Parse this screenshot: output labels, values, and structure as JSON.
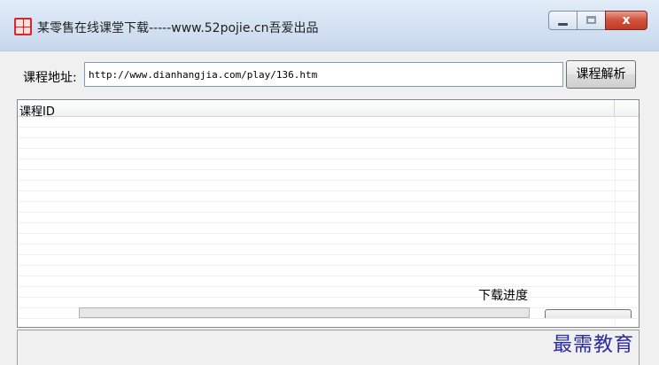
{
  "window": {
    "title": "某零售在线课堂下载-----www.52pojie.cn吾爱出品",
    "close_glyph": "x"
  },
  "form": {
    "url_label": "课程地址:",
    "url_value": "http://www.dianhangjia.com/play/136.htm",
    "parse_button": "课程解析"
  },
  "list": {
    "columns": [
      "课程ID"
    ],
    "rows": []
  },
  "footer": {
    "progress_label": "下载进度",
    "progress": 0
  },
  "watermark": "最需教育",
  "colors": {
    "accent": "#06b025",
    "close": "#c13a26",
    "watermark": "#2a2aa0"
  }
}
